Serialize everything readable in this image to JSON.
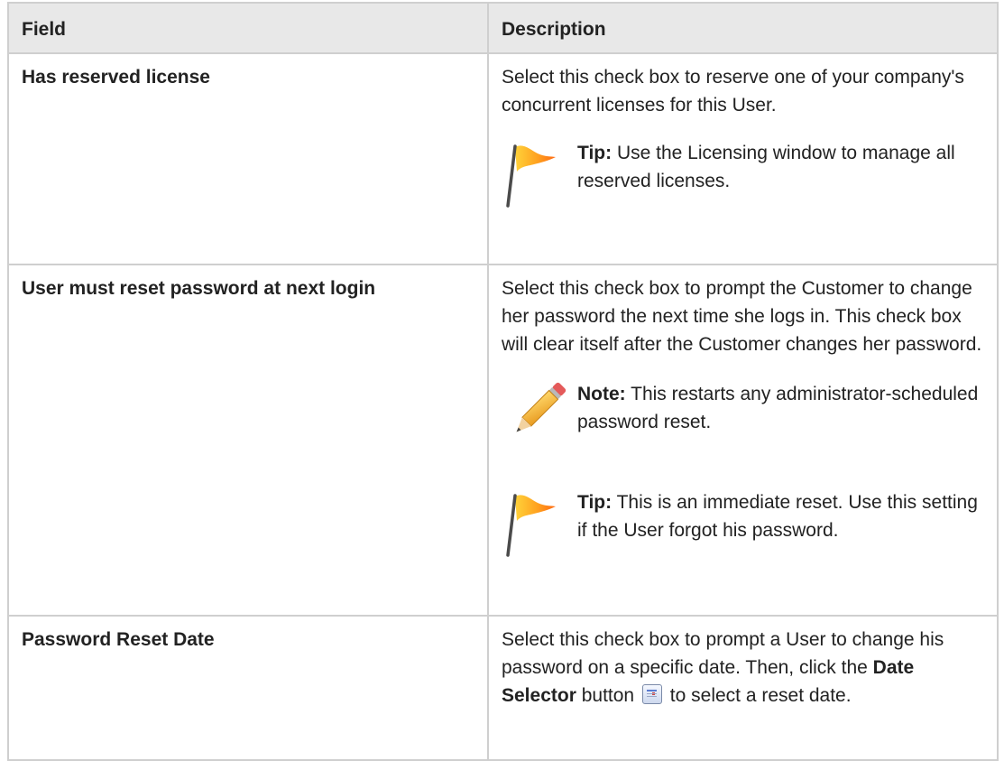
{
  "table": {
    "headers": {
      "field": "Field",
      "description": "Description"
    },
    "rows": [
      {
        "field": "Has reserved license",
        "description": "Select this check box to reserve one of your company's concurrent licenses for this User.",
        "tip": {
          "label": "Tip:",
          "text": " Use the Licensing window to manage all reserved licenses."
        }
      },
      {
        "field": "User must reset password at next login",
        "description": "Select this check box to prompt the Customer to change her password the next time she logs in. This check box will clear itself after the Customer changes her password.",
        "note": {
          "label": "Note:",
          "text": " This restarts any administrator-scheduled password reset."
        },
        "tip": {
          "label": "Tip:",
          "text": " This is an immediate reset. Use this setting if the User forgot his password."
        }
      },
      {
        "field": "Password Reset Date",
        "description_before": "Select this check box to prompt a User to change his password on a specific date. Then, click the ",
        "description_bold": "Date Selector",
        "description_mid": " button",
        "description_after": " to select a reset date."
      }
    ]
  },
  "icons": {
    "tip": "flag-icon",
    "note": "pencil-icon",
    "date_selector": "calendar-icon"
  }
}
